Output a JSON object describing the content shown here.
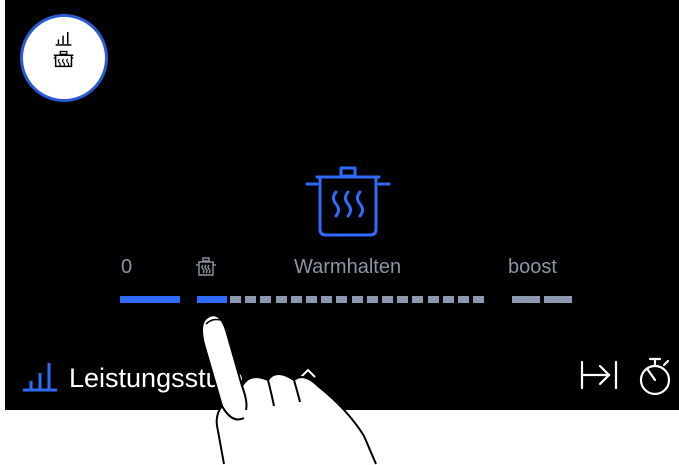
{
  "labels": {
    "zero": "0",
    "warm": "Warmhalten",
    "boost": "boost"
  },
  "footer": {
    "label": "Leistungsstufe"
  },
  "slider": {
    "level": 1,
    "levels": [
      "0",
      "warm-keeping",
      "1",
      "2",
      "3",
      "4",
      "5",
      "6",
      "7",
      "8",
      "9",
      "10",
      "11",
      "12",
      "13",
      "14",
      "15",
      "16",
      "17",
      "boost"
    ]
  },
  "colors": {
    "background": "#000000",
    "accent_blue": "#2f6bff",
    "inactive_segment": "#8c97b0",
    "label_grey": "#8a94a6",
    "text_white": "#ffffff"
  },
  "icons": {
    "mode_button": "power-level-and-pot-icon",
    "large_pot": "steaming-pot-icon",
    "small_pot": "steaming-pot-icon",
    "footer_icon": "power-level-bars-icon",
    "expand": "chevron-up-icon",
    "collapse": "arrow-to-bar-icon",
    "timer": "stopwatch-icon"
  }
}
